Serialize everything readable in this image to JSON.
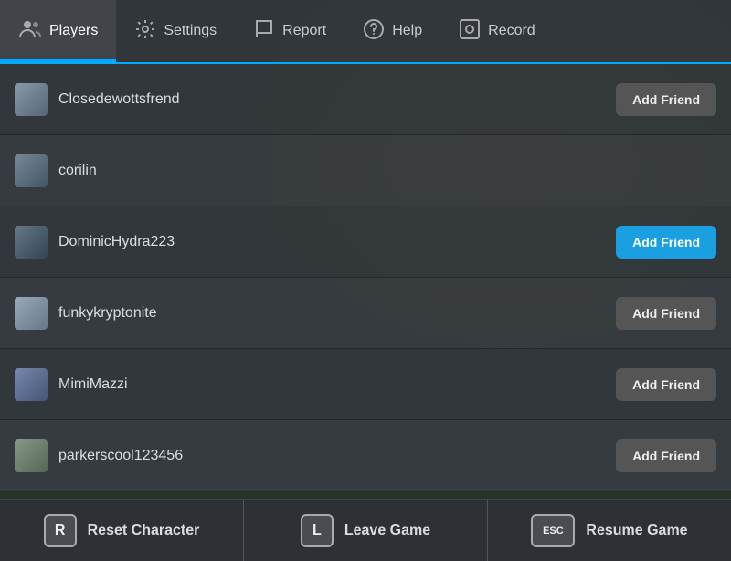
{
  "nav": {
    "items": [
      {
        "id": "players",
        "label": "Players",
        "icon": "👥",
        "active": true
      },
      {
        "id": "settings",
        "label": "Settings",
        "icon": "⚙️",
        "active": false
      },
      {
        "id": "report",
        "label": "Report",
        "icon": "🚩",
        "active": false
      },
      {
        "id": "help",
        "label": "Help",
        "icon": "❓",
        "active": false
      },
      {
        "id": "record",
        "label": "Record",
        "icon": "⏺",
        "active": false
      }
    ]
  },
  "players": [
    {
      "name": "Closedewottsfrend",
      "has_add_friend": true,
      "add_friend_blue": false
    },
    {
      "name": "corilin",
      "has_add_friend": false,
      "add_friend_blue": false
    },
    {
      "name": "DominicHydra223",
      "has_add_friend": true,
      "add_friend_blue": true
    },
    {
      "name": "funkykryptonite",
      "has_add_friend": true,
      "add_friend_blue": false
    },
    {
      "name": "MimiMazzi",
      "has_add_friend": true,
      "add_friend_blue": false
    },
    {
      "name": "parkerscool123456",
      "has_add_friend": true,
      "add_friend_blue": false
    }
  ],
  "add_friend_label": "Add Friend",
  "toolbar": {
    "buttons": [
      {
        "key": "R",
        "label": "Reset Character"
      },
      {
        "key": "L",
        "label": "Leave Game"
      },
      {
        "key": "ESC",
        "label": "Resume Game"
      }
    ]
  }
}
